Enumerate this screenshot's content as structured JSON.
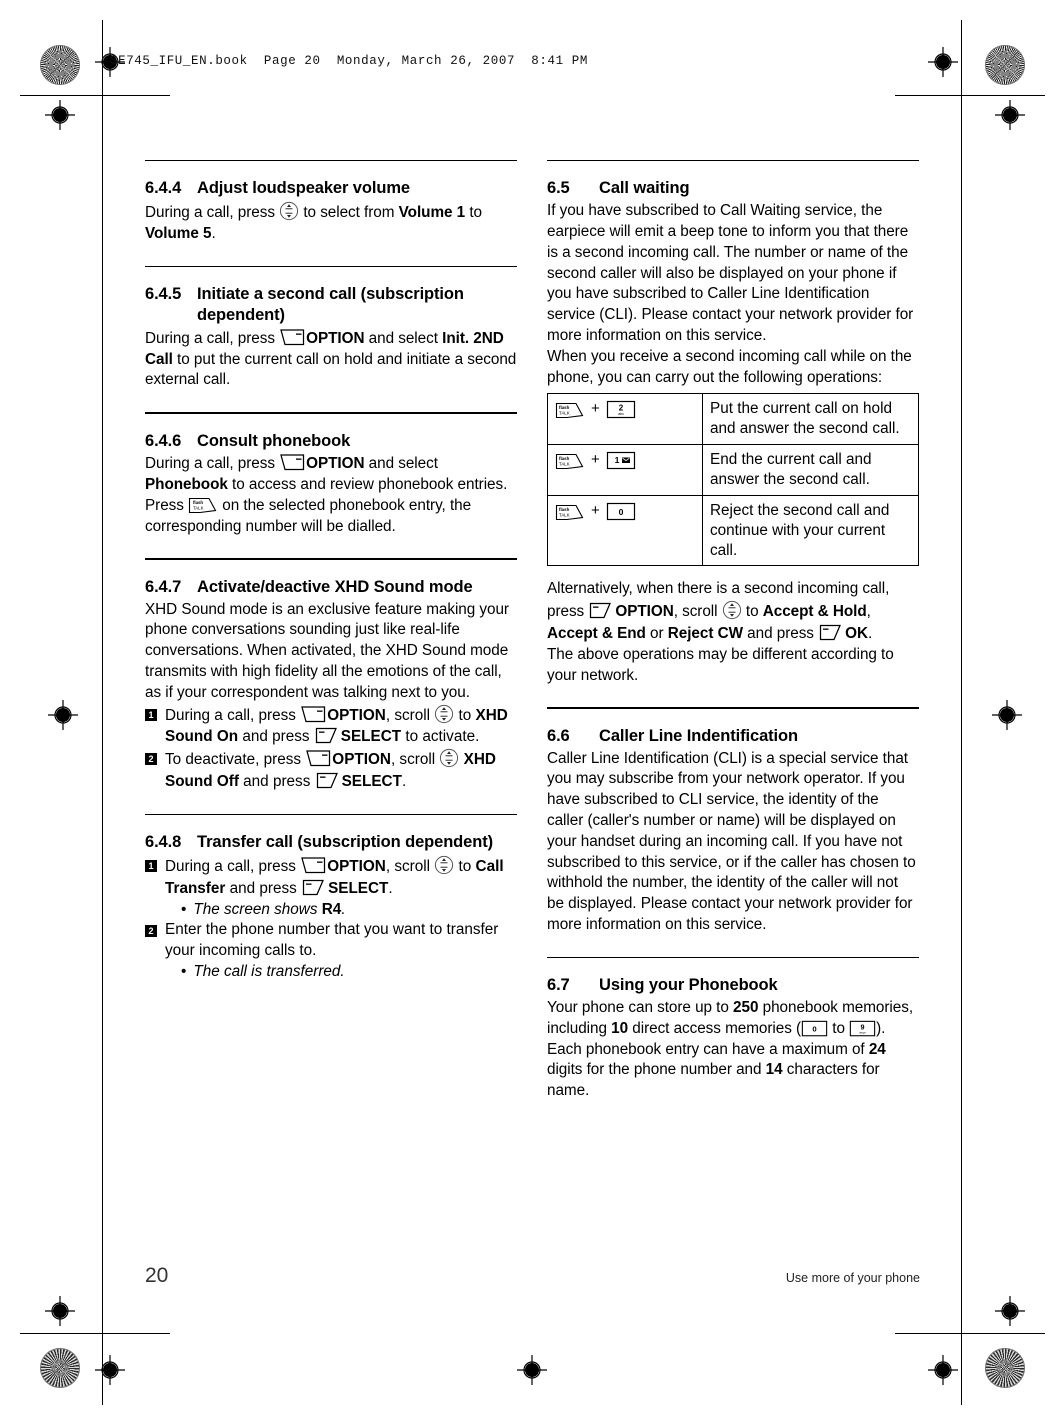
{
  "page_header": "SE745_IFU_EN.book  Page 20  Monday, March 26, 2007  8:41 PM",
  "footer": {
    "page_number": "20",
    "running_head": "Use more of your phone"
  },
  "icons": {
    "softkey_left": "left-softkey-icon",
    "softkey_right": "right-softkey-icon",
    "nav_key": "up-down-navigation-key-icon",
    "talk_key": "flash-talk-key-icon",
    "key_2": "keypad-2-abc-icon",
    "key_1": "keypad-1-voicemail-icon",
    "key_0": "keypad-0-icon",
    "key_9": "keypad-9-wxyz-icon"
  },
  "key_labels": {
    "flash": "flash",
    "talk": "TALK",
    "two": "2",
    "two_sub": "abc",
    "one": "1",
    "zero": "0",
    "nine": "9",
    "nine_sub": "wxyz"
  },
  "left_column": {
    "s644": {
      "number": "6.4.4",
      "title": "Adjust loudspeaker volume",
      "p1_a": "During a call, press ",
      "p1_b": " to select from ",
      "p1_bold1": "Volume 1",
      "p1_c": " to ",
      "p1_bold2": "Volume 5",
      "p1_d": "."
    },
    "s645": {
      "number": "6.4.5",
      "title": "Initiate a second call (subscription dependent)",
      "p1_a": "During a call, press ",
      "p1_option": "OPTION",
      "p1_b": " and select ",
      "p1_bold": "Init. 2ND Call",
      "p1_c": " to put the current call on hold and initiate a second external call."
    },
    "s646": {
      "number": "6.4.6",
      "title": "Consult phonebook",
      "p1_a": "During a call, press ",
      "p1_option": "OPTION",
      "p1_b": " and select ",
      "p1_bold": "Phonebook",
      "p1_c": " to access and review phonebook entries.",
      "p2_a": "Press ",
      "p2_b": " on the selected phonebook entry, the corresponding number will be dialled."
    },
    "s647": {
      "number": "6.4.7",
      "title": "Activate/deactive XHD Sound mode",
      "p1": "XHD Sound mode is an exclusive feature making your phone conversations sounding just like real-life conversations. When activated, the XHD Sound mode transmits with high fidelity all the emotions of the call, as if your correspondent was talking next to you.",
      "step1_a": "During a call, press ",
      "step1_option": "OPTION",
      "step1_b": ", scroll ",
      "step1_c": " to ",
      "step1_bold": "XHD Sound On",
      "step1_d": " and press ",
      "step1_select": "SELECT",
      "step1_e": " to activate.",
      "step2_a": "To deactivate, press ",
      "step2_option": "OPTION",
      "step2_b": ", scroll ",
      "step2_c": " ",
      "step2_bold": "XHD Sound Off",
      "step2_d": " and press ",
      "step2_select": "SELECT",
      "step2_e": "."
    },
    "s648": {
      "number": "6.4.8",
      "title": "Transfer call (subscription dependent)",
      "step1_a": "During a call, press ",
      "step1_option": "OPTION",
      "step1_b": ", scroll ",
      "step1_c": " to ",
      "step1_bold": "Call Transfer",
      "step1_d": " and press ",
      "step1_select": "SELECT",
      "step1_e": ".",
      "step1_sub_a": "The screen shows ",
      "step1_sub_bold": "R4",
      "step1_sub_b": ".",
      "step2": "Enter the phone number that you want to transfer your incoming calls to.",
      "step2_sub": "The call is transferred."
    }
  },
  "right_column": {
    "s65": {
      "number": "6.5",
      "title": "Call waiting",
      "p1": "If you have subscribed to Call Waiting service, the earpiece will emit a beep tone to inform you that there is a second incoming call. The number or name of the second caller will also be displayed on your phone if you have subscribed to Caller Line Identification service (CLI). Please contact your network provider for more information on this service.",
      "p2": "When you receive a second incoming call while on the phone, you can carry out the following operations:",
      "table_rows": [
        {
          "key_combo": "flash-talk + 2",
          "description": "Put the current call on hold and answer the second call."
        },
        {
          "key_combo": "flash-talk + 1",
          "description": "End the current call and answer the second call."
        },
        {
          "key_combo": "flash-talk + 0",
          "description": "Reject the second call and continue with your current call."
        }
      ],
      "plus": "+",
      "p3_a": "Alternatively, when there is a second incoming call, press ",
      "p3_option": "OPTION",
      "p3_b": ", scroll ",
      "p3_c": " to ",
      "p3_bold1": "Accept & Hold",
      "p3_d": ", ",
      "p3_bold2": "Accept & End",
      "p3_e": " or ",
      "p3_bold3": "Reject CW",
      "p3_f": " and press ",
      "p3_ok": "OK",
      "p3_g": ".",
      "p4": "The above operations may be different according to your network."
    },
    "s66": {
      "number": "6.6",
      "title": "Caller Line Indentification",
      "p1": "Caller Line Identification (CLI) is a special service that you may subscribe from your network operator. If you have subscribed to CLI service, the identity of the caller (caller's number or name) will be displayed on your handset during an incoming call. If you have not subscribed to this service, or if the caller has chosen to withhold the number, the identity of the caller will not be displayed. Please contact your network provider for more information on this service."
    },
    "s67": {
      "number": "6.7",
      "title": "Using your Phonebook",
      "p1_a": "Your phone can store up to ",
      "p1_b250": "250",
      "p1_b": " phonebook memories, including ",
      "p1_b10": "10",
      "p1_c": " direct access memories (",
      "p1_d": " to ",
      "p1_e": "). Each phonebook entry can have a maximum of ",
      "p1_b24": "24",
      "p1_f": " digits for the phone number and ",
      "p1_b14": "14",
      "p1_g": " characters for name."
    }
  }
}
